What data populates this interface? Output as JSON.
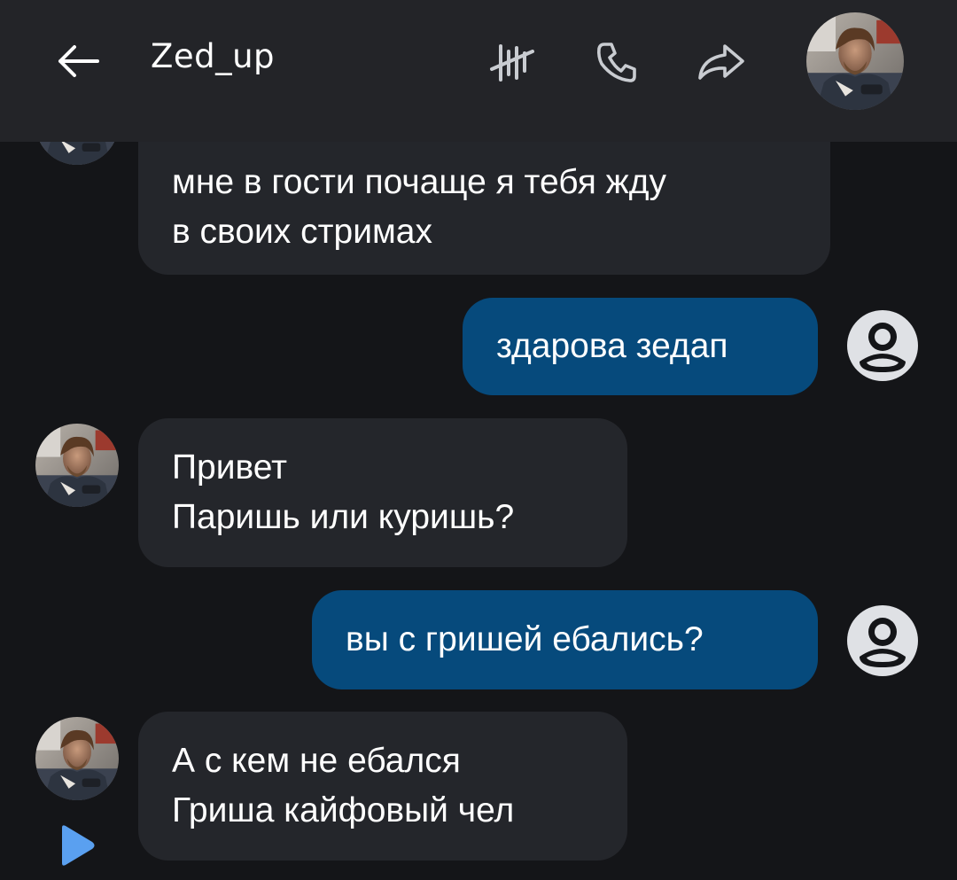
{
  "header": {
    "title": "Zed_up",
    "icons": [
      "arrow-left-icon",
      "vk-tally-icon",
      "phone-icon",
      "share-arrow-icon"
    ]
  },
  "colors": {
    "background": "#141518",
    "header": "#232428",
    "incoming_bubble": "#24262b",
    "outgoing_bubble": "#064a7c",
    "text": "#ffffff",
    "icon": "#c9ccd1",
    "accent": "#5aa0f0"
  },
  "messages": [
    {
      "direction": "incoming",
      "lines": [
        "мне в гости почаще я тебя жду",
        "в своих стримах"
      ]
    },
    {
      "direction": "outgoing",
      "lines": [
        "здарова зедап"
      ]
    },
    {
      "direction": "incoming",
      "lines": [
        "Привет",
        "Паришь или куришь?"
      ]
    },
    {
      "direction": "outgoing",
      "lines": [
        "вы с гришей ебались?"
      ]
    },
    {
      "direction": "incoming",
      "lines": [
        "А с кем не ебался",
        "Гриша кайфовый чел"
      ]
    }
  ]
}
